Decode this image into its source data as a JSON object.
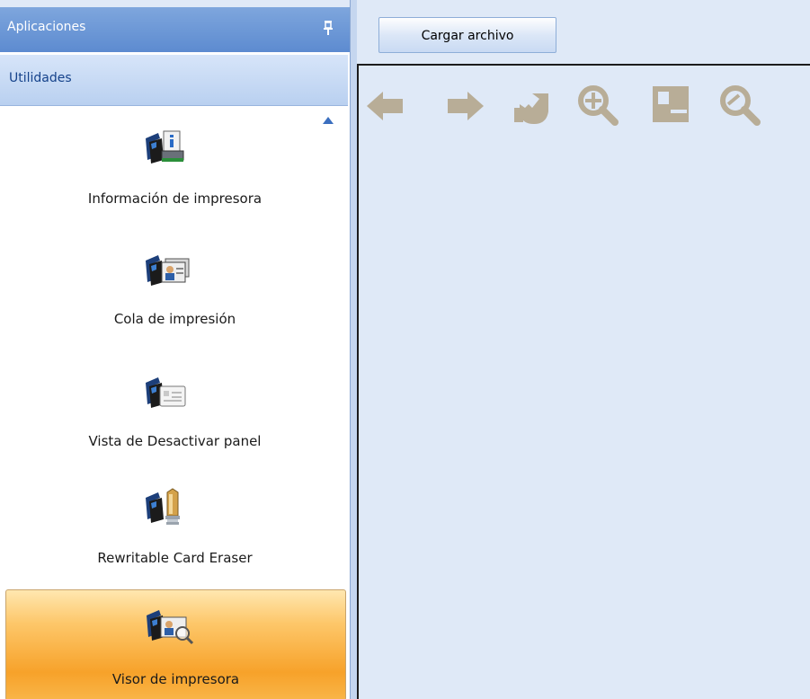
{
  "sidebar": {
    "header_title": "Aplicaciones",
    "pin_icon": "pin-icon",
    "category_label": "Utilidades",
    "items": [
      {
        "label": "Información de impresora",
        "icon": "printer-info-icon",
        "selected": false
      },
      {
        "label": "Cola de impresión",
        "icon": "print-queue-icon",
        "selected": false
      },
      {
        "label": "Vista de Desactivar panel",
        "icon": "disable-panel-view-icon",
        "selected": false
      },
      {
        "label": "Rewritable Card Eraser",
        "icon": "card-eraser-icon",
        "selected": false
      },
      {
        "label": "Visor de impresora",
        "icon": "printer-viewer-icon",
        "selected": true
      }
    ]
  },
  "main": {
    "load_button_label": "Cargar archivo",
    "toolbar_icons": [
      "arrow-left-icon",
      "arrow-right-icon",
      "rotate-icon",
      "zoom-in-icon",
      "fit-page-icon",
      "zoom-out-icon"
    ]
  },
  "colors": {
    "header_blue": "#5d8bd0",
    "selected_orange": "#f7a22a",
    "disabled_icon": "#b8ad97"
  }
}
